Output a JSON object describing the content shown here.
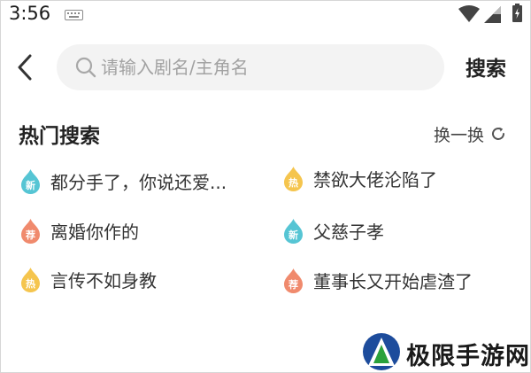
{
  "status_bar": {
    "time": "3:56",
    "icons": [
      "keyboard-icon",
      "wifi-icon",
      "signal-icon",
      "battery-icon"
    ]
  },
  "search": {
    "back_icon": "chevron-left-icon",
    "placeholder": "请输入剧名/主角名",
    "value": "",
    "button_label": "搜索"
  },
  "hot_search": {
    "title": "热门搜索",
    "refresh_label": "换一换",
    "items": [
      {
        "text": "都分手了，你说还爱...",
        "badge": "新",
        "badge_color": "#56c5d4"
      },
      {
        "text": "禁欲大佬沦陷了",
        "badge": "热",
        "badge_color": "#f5c54e"
      },
      {
        "text": "离婚你作的",
        "badge": "荐",
        "badge_color": "#f08a6d"
      },
      {
        "text": "父慈子孝",
        "badge": "新",
        "badge_color": "#56c5d4"
      },
      {
        "text": "言传不如身教",
        "badge": "热",
        "badge_color": "#f5c54e"
      },
      {
        "text": "董事长又开始虐渣了",
        "badge": "荐",
        "badge_color": "#f08a6d"
      }
    ]
  },
  "watermark": {
    "text": "极限手游网",
    "colors": {
      "logo_blue": "#1d4c9c",
      "logo_green": "#2aa13b"
    }
  }
}
